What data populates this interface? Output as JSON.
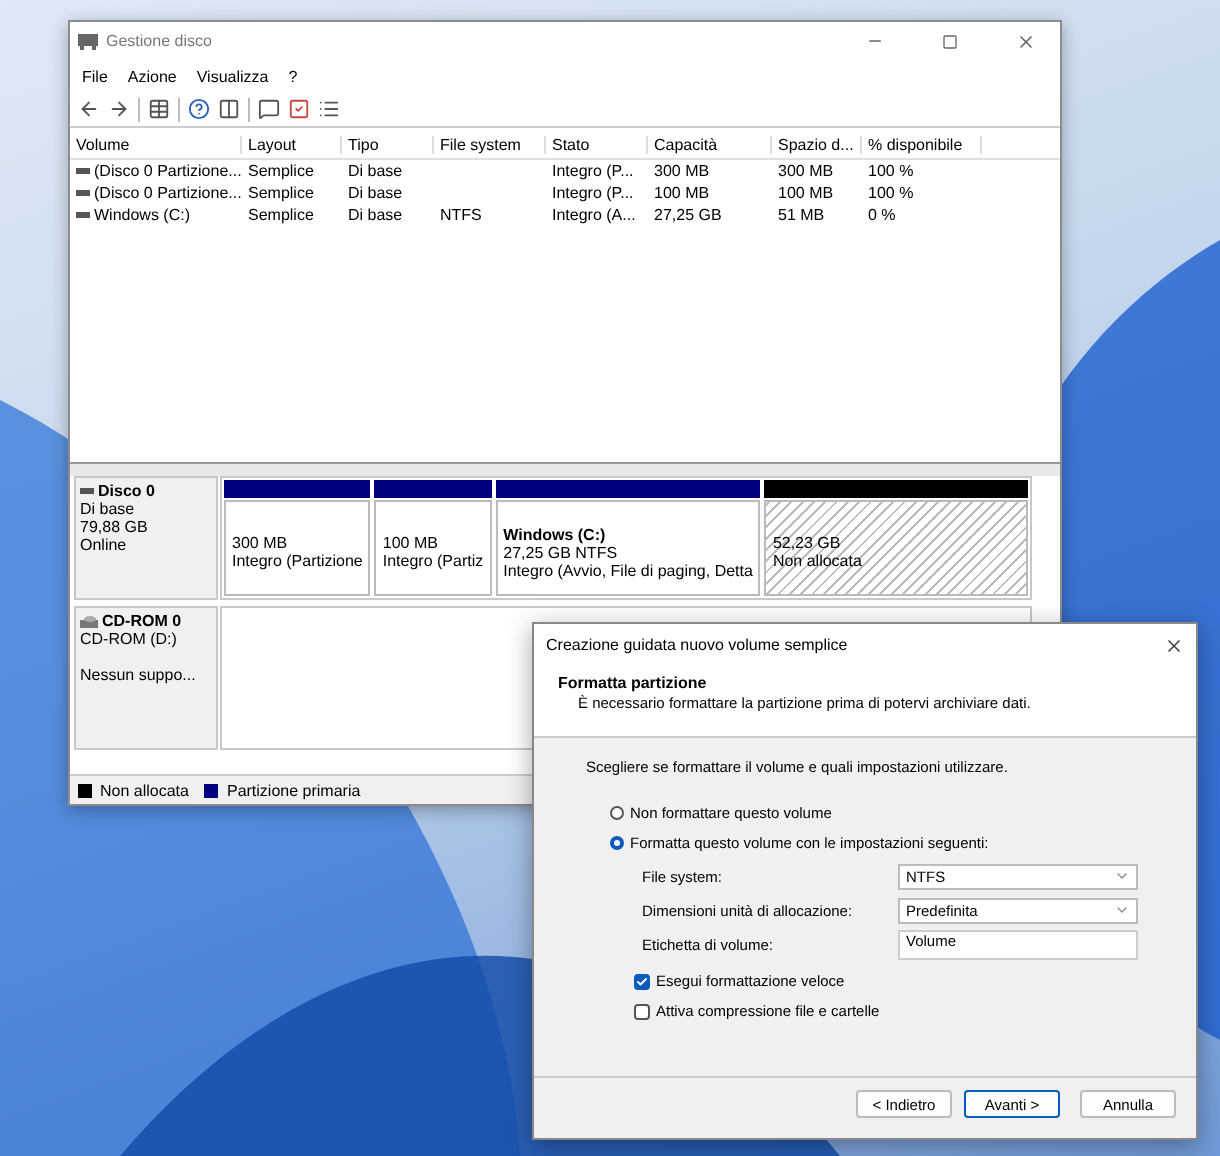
{
  "main_window": {
    "title": "Gestione disco",
    "menu": [
      "File",
      "Azione",
      "Visualizza",
      "?"
    ]
  },
  "volume_table": {
    "columns": [
      "Volume",
      "Layout",
      "Tipo",
      "File system",
      "Stato",
      "Capacità",
      "Spazio d...",
      "% disponibile"
    ],
    "rows": [
      [
        "(Disco 0 Partizione...",
        "Semplice",
        "Di base",
        "",
        "Integro (P...",
        "300 MB",
        "300 MB",
        "100 %"
      ],
      [
        "(Disco 0 Partizione...",
        "Semplice",
        "Di base",
        "",
        "Integro (P...",
        "100 MB",
        "100 MB",
        "100 %"
      ],
      [
        "Windows (C:)",
        "Semplice",
        "Di base",
        "NTFS",
        "Integro (A...",
        "27,25 GB",
        "51 MB",
        "0 %"
      ]
    ]
  },
  "disks": [
    {
      "name": "Disco 0",
      "kind": "disk",
      "lines": [
        "Di base",
        "79,88 GB",
        "Online"
      ],
      "partitions": [
        {
          "kind": "primary",
          "lines": [
            "300 MB",
            "Integro (Partizione"
          ]
        },
        {
          "kind": "primary",
          "lines": [
            "100 MB",
            "Integro (Partiz"
          ]
        },
        {
          "kind": "primary",
          "title": "Windows  (C:)",
          "lines": [
            "27,25 GB NTFS",
            "Integro (Avvio, File di paging, Detta"
          ]
        },
        {
          "kind": "unallocated",
          "lines": [
            "52,23 GB",
            "Non allocata"
          ]
        }
      ]
    },
    {
      "name": "CD-ROM 0",
      "kind": "cdrom",
      "lines": [
        "CD-ROM (D:)",
        "Nessun suppo..."
      ]
    }
  ],
  "legend": [
    {
      "label": "Non allocata",
      "color": "#000000"
    },
    {
      "label": "Partizione primaria",
      "color": "#000080"
    }
  ],
  "wizard": {
    "title": "Creazione guidata nuovo volume semplice",
    "heading": "Formatta partizione",
    "subtitle": "È necessario formattare la partizione prima di potervi archiviare dati.",
    "prompt": "Scegliere se formattare il volume e quali impostazioni utilizzare.",
    "options": [
      {
        "label": "Non formattare questo volume",
        "selected": false
      },
      {
        "label": "Formatta questo volume con le impostazioni seguenti:",
        "selected": true
      }
    ],
    "fields": [
      {
        "kind": "dropdown",
        "label": "File system:",
        "value": "NTFS"
      },
      {
        "kind": "dropdown",
        "label": "Dimensioni unità di allocazione:",
        "value": "Predefinita"
      },
      {
        "kind": "text",
        "label": "Etichetta di volume:",
        "value": "Volume"
      }
    ],
    "checkboxes": [
      {
        "label": "Esegui formattazione veloce",
        "checked": true
      },
      {
        "label": "Attiva compressione file e cartelle",
        "checked": false
      }
    ],
    "buttons": [
      {
        "label": "< Indietro",
        "selected": false
      },
      {
        "label": "Avanti >",
        "selected": true
      },
      {
        "label": "Annulla",
        "selected": false
      }
    ]
  }
}
